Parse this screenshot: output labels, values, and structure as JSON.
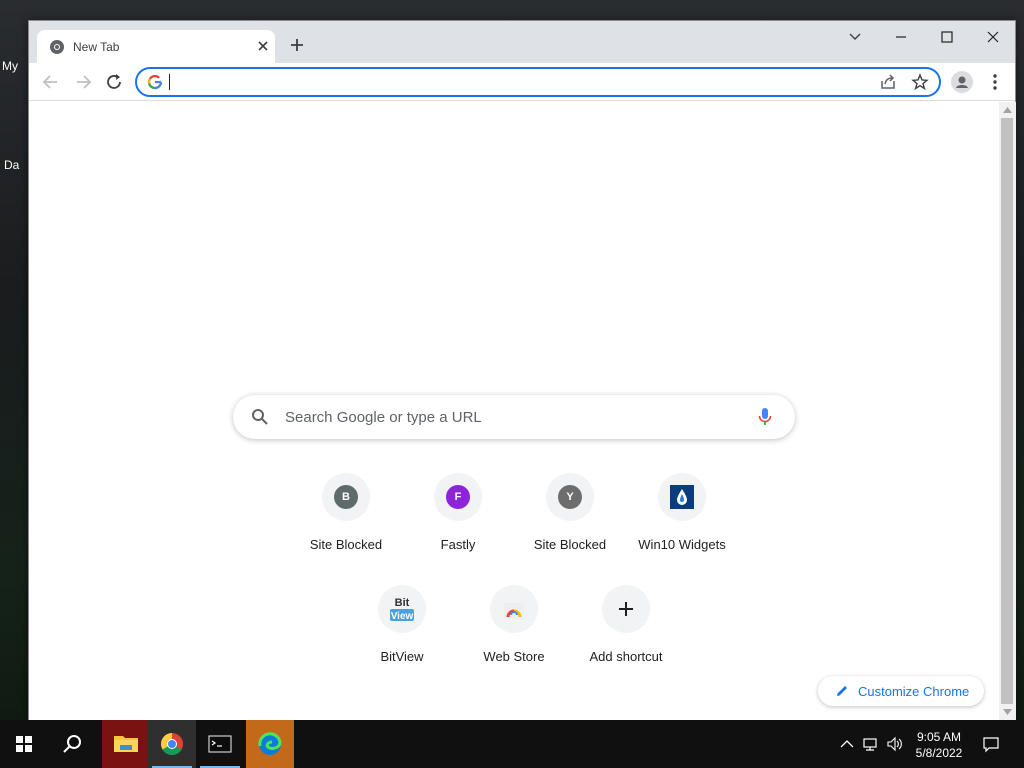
{
  "desktop": {
    "label_1": "My",
    "label_2": "Da"
  },
  "browser": {
    "tab": {
      "title": "New Tab"
    },
    "omnibox": {
      "value": ""
    }
  },
  "newtab": {
    "search_placeholder": "Search Google or type a URL",
    "shortcuts": [
      {
        "label": "Site Blocked",
        "letter": "B",
        "color": "#5f6b6b"
      },
      {
        "label": "Fastly",
        "letter": "F",
        "color": "#8e24d8"
      },
      {
        "label": "Site Blocked",
        "letter": "Y",
        "color": "#6d6d6d"
      },
      {
        "label": "Win10 Widgets",
        "icon": "water-drop-icon",
        "color": "#0b3d7a"
      },
      {
        "label": "BitView",
        "icon": "bitview-logo",
        "logo_text": "Bit\nView"
      },
      {
        "label": "Web Store",
        "icon": "chrome-web-store-icon"
      },
      {
        "label": "Add shortcut",
        "icon": "plus-icon"
      }
    ],
    "customize_label": "Customize Chrome"
  },
  "taskbar": {
    "time": "9:05 AM",
    "date": "5/8/2022",
    "apps": [
      "file-explorer-icon",
      "chrome-icon",
      "terminal-icon",
      "edge-icon"
    ]
  },
  "colors": {
    "accent": "#1a73e8",
    "tabstrip": "#dee1e6",
    "taskbar": "#101010"
  }
}
